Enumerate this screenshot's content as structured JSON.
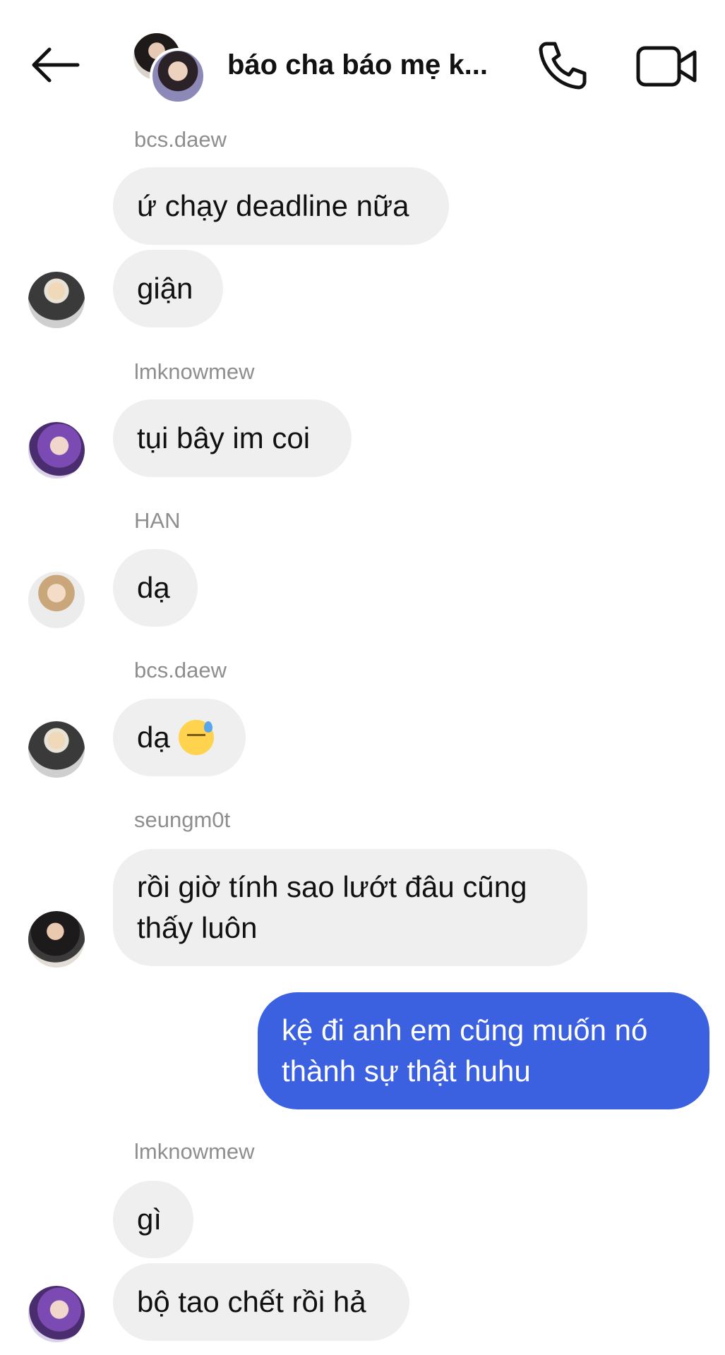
{
  "header": {
    "title": "báo cha báo mẹ k...",
    "back_icon": "arrow-left-icon",
    "call_icon": "phone-icon",
    "video_icon": "video-camera-icon"
  },
  "messages": [
    {
      "sender": "bcs.daew",
      "texts": [
        "ứ chạy deadline nữa",
        "giận"
      ]
    },
    {
      "sender": "lmknowmew",
      "texts": [
        "tụi bây im coi"
      ]
    },
    {
      "sender": "HAN",
      "texts": [
        "dạ"
      ]
    },
    {
      "sender": "bcs.daew",
      "texts": [
        "dạ"
      ],
      "emoji": "downcast-face-with-sweat-icon"
    },
    {
      "sender": "seungm0t",
      "texts": [
        "rồi giờ tính sao lướt đâu cũng",
        "thấy luôn"
      ]
    },
    {
      "sender": "me",
      "texts": [
        "kệ đi anh em cũng muốn nó",
        "thành sự thật huhu"
      ]
    },
    {
      "sender": "lmknowmew",
      "texts": [
        "gì",
        "bộ tao chết rồi hả"
      ]
    }
  ],
  "colors": {
    "my_bubble": "#3b61e0",
    "their_bubble": "#efefef",
    "sender_label": "#8e8e8e"
  }
}
